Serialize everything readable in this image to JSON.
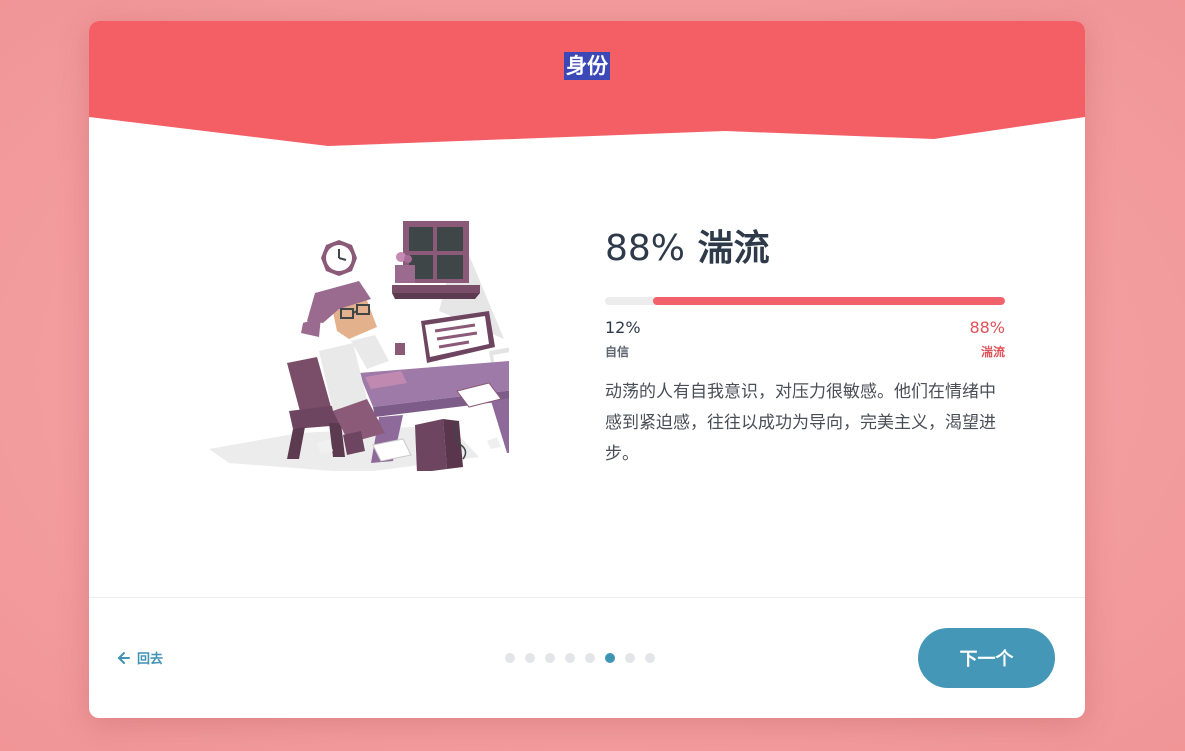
{
  "header": {
    "title": "身份"
  },
  "result": {
    "percent_label": "88%",
    "type_name": "湍流",
    "bar": {
      "fill_fraction": 0.88,
      "left_percent": "12%",
      "left_name": "自信",
      "right_percent": "88%",
      "right_name": "湍流"
    },
    "description": "动荡的人有自我意识，对压力很敏感。他们在情绪中感到紧迫感，往往以成功为导向，完美主义，渴望进步。"
  },
  "footer": {
    "back_label": "回去",
    "next_label": "下一个",
    "dots_total": 8,
    "dots_active_index": 5
  },
  "colors": {
    "header": "#f45f66",
    "accent": "#4497b7",
    "bar_fill": "#f2626a",
    "background": "#f39ea0"
  },
  "icons": {
    "back": "arrow-left-icon"
  }
}
